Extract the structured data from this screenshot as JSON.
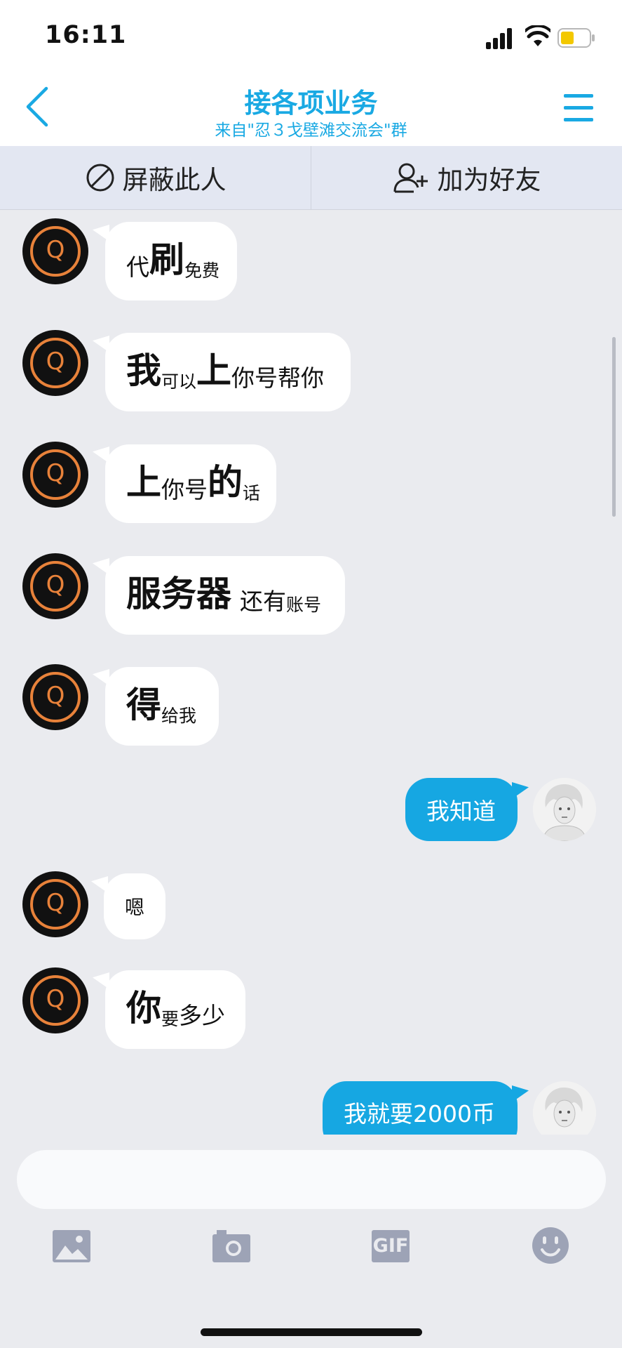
{
  "status_bar": {
    "time": "16:11"
  },
  "nav": {
    "title": "接各项业务",
    "subtitle": "来自\"忍３戈壁滩交流会\"群"
  },
  "actions": {
    "block_label": "屏蔽此人",
    "add_friend_label": "加为好友"
  },
  "messages": [
    {
      "side": "left",
      "segments": [
        "代",
        "刷",
        "免费"
      ]
    },
    {
      "side": "left",
      "segments": [
        "我",
        "可以",
        "上",
        "你号帮你"
      ]
    },
    {
      "side": "left",
      "segments": [
        "上",
        "你号",
        "的",
        "话"
      ]
    },
    {
      "side": "left",
      "segments": [
        "服务器",
        "还有",
        "账号"
      ]
    },
    {
      "side": "left",
      "segments": [
        "得",
        "给我"
      ]
    },
    {
      "side": "right",
      "text": "我知道"
    },
    {
      "side": "left",
      "text": "嗯"
    },
    {
      "side": "left",
      "segments": [
        "你",
        "要",
        "多少"
      ]
    },
    {
      "side": "right",
      "text": "我就要2000币"
    }
  ],
  "input": {
    "placeholder": ""
  },
  "toolbar": {
    "items": [
      "image-icon",
      "camera-icon",
      "gif-icon",
      "emoji-icon"
    ],
    "gif_label": "GIF"
  },
  "colors": {
    "accent": "#19a9e3",
    "bubble_right": "#16a7e2",
    "bubble_left": "#ffffff",
    "background": "#eaebef",
    "avatar_ring": "#e8823a"
  }
}
